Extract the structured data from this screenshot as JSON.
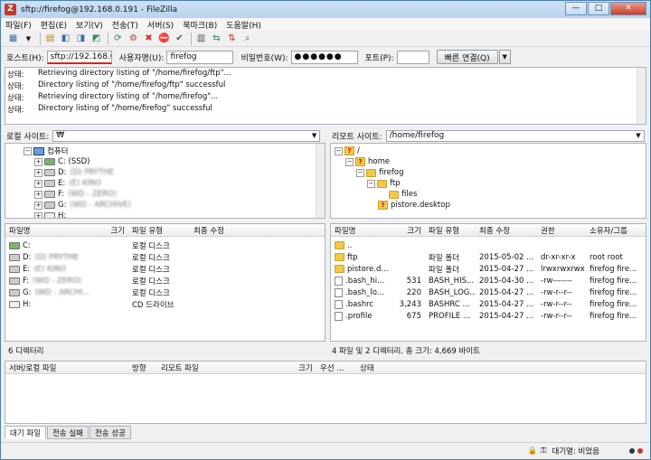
{
  "window": {
    "title": "sftp://firefog@192.168.0.191 - FileZilla",
    "app_icon": "Z"
  },
  "menu": [
    "파일(F)",
    "편집(E)",
    "보기(V)",
    "전송(T)",
    "서버(S)",
    "북마크(B)",
    "도움말(H)"
  ],
  "quickconnect": {
    "host_label": "호스트(H):",
    "host_value": "sftp://192.168.0.19",
    "user_label": "사용자명(U):",
    "user_value": "firefog",
    "pass_label": "비밀번호(W):",
    "pass_value": "●●●●●●",
    "port_label": "포트(P):",
    "port_value": "",
    "connect_label": "빠른 연결(Q)"
  },
  "log": [
    {
      "type": "상태:",
      "msg": "Retrieving directory listing of \"/home/firefog/ftp\"..."
    },
    {
      "type": "상태:",
      "msg": "Directory listing of \"/home/firefog/ftp\" successful"
    },
    {
      "type": "상태:",
      "msg": "Retrieving directory listing of \"/home/firefog\"..."
    },
    {
      "type": "상태:",
      "msg": "Directory listing of \"/home/firefog\" successful"
    }
  ],
  "local": {
    "site_label": "로컬 사이트:",
    "site_value": "₩",
    "tree": {
      "root": "컴퓨터",
      "drives": [
        "C: (SSD)",
        "D:",
        "E:",
        "F:",
        "G:",
        "H:"
      ]
    },
    "headers": [
      "파일명",
      "크기",
      "파일 유형",
      "최종 수정"
    ],
    "files": [
      {
        "name": "C:",
        "type": "로컬 디스크"
      },
      {
        "name": "D:",
        "type": "로컬 디스크"
      },
      {
        "name": "E:",
        "type": "로컬 디스크"
      },
      {
        "name": "F:",
        "type": "로컬 디스크"
      },
      {
        "name": "G:",
        "type": "로컬 디스크"
      },
      {
        "name": "H:",
        "type": "CD 드라이브"
      }
    ],
    "status": "6 디렉터리"
  },
  "remote": {
    "site_label": "리모트 사이트:",
    "site_value": "/home/firefog",
    "tree": [
      "/",
      "home",
      "firefog",
      "ftp",
      "files",
      "pistore.desktop"
    ],
    "headers": [
      "파일명",
      "크기",
      "파일 유형",
      "최종 수정",
      "권한",
      "소유자/그룹"
    ],
    "files": [
      {
        "name": "..",
        "size": "",
        "type": "",
        "date": "",
        "perm": "",
        "owner": ""
      },
      {
        "name": "ftp",
        "size": "",
        "type": "파일 폴더",
        "date": "2015-05-02 ...",
        "perm": "dr-xr-xr-x",
        "owner": "root root"
      },
      {
        "name": "pistore.d...",
        "size": "",
        "type": "파일 폴더",
        "date": "2015-04-27 ...",
        "perm": "lrwxrwxrwx",
        "owner": "firefog fire..."
      },
      {
        "name": ".bash_hi...",
        "size": "531",
        "type": "BASH_HIS...",
        "date": "2015-04-30 ...",
        "perm": "-rw-------",
        "owner": "firefog fire..."
      },
      {
        "name": ".bash_lo...",
        "size": "220",
        "type": "BASH_LOG...",
        "date": "2015-04-27 ...",
        "perm": "-rw-r--r--",
        "owner": "firefog fire..."
      },
      {
        "name": ".bashrc",
        "size": "3,243",
        "type": "BASHRC ...",
        "date": "2015-04-27 ...",
        "perm": "-rw-r--r--",
        "owner": "firefog fire..."
      },
      {
        "name": ".profile",
        "size": "675",
        "type": "PROFILE ...",
        "date": "2015-04-27 ...",
        "perm": "-rw-r--r--",
        "owner": "firefog fire..."
      }
    ],
    "status": "4 파일 및 2 디렉터리. 총 크기: 4,669 바이트"
  },
  "queue": {
    "headers": [
      "서버/로컬 파일",
      "방향",
      "리모트 파일",
      "크기",
      "우선 ...",
      "상태"
    ]
  },
  "tabs": [
    "대기 파일",
    "전송 실패",
    "전송 성공"
  ],
  "statusbar": {
    "queue": "대기열: 비었음"
  }
}
